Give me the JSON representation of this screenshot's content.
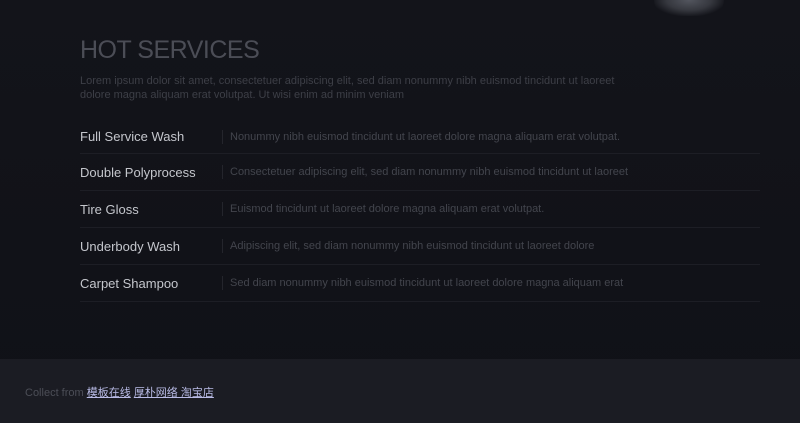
{
  "section": {
    "title": "HOT SERVICES",
    "intro": "Lorem ipsum dolor sit amet, consectetuer adipiscing elit, sed diam nonummy nibh euismod tincidunt ut laoreet dolore magna aliquam erat volutpat. Ut wisi enim ad minim veniam"
  },
  "services": [
    {
      "name": "Full Service Wash",
      "description": "Nonummy nibh euismod tincidunt ut laoreet dolore magna aliquam erat volutpat."
    },
    {
      "name": "Double Polyprocess",
      "description": "Consectetuer adipiscing elit, sed diam nonummy nibh euismod tincidunt ut laoreet"
    },
    {
      "name": "Tire Gloss",
      "description": "Euismod tincidunt ut laoreet dolore magna aliquam erat volutpat."
    },
    {
      "name": "Underbody Wash",
      "description": "Adipiscing elit, sed diam nonummy nibh euismod tincidunt ut laoreet dolore"
    },
    {
      "name": "Carpet Shampoo",
      "description": "Sed diam nonummy nibh euismod tincidunt ut laoreet dolore magna aliquam erat"
    }
  ],
  "footer": {
    "prefix": "Collect from ",
    "link1": "模板在线",
    "space": " ",
    "link2": "厚朴网络 淘宝店"
  },
  "colors": {
    "background": "#121319",
    "footer_bg": "#1b1c23",
    "title": "#4b4d56",
    "service_name": "#c4c6cc",
    "link": "#b9bbe6"
  }
}
